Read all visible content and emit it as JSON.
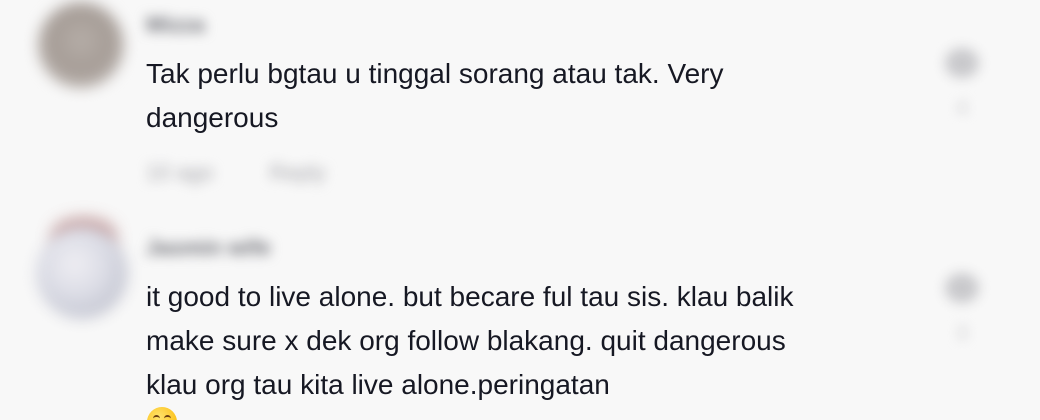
{
  "comments": [
    {
      "username": "Mizza",
      "text_lines": [
        "Tak perlu bgtau u tinggal sorang atau tak. Very",
        "dangerous"
      ],
      "time": "10 ago",
      "reply_label": "Reply",
      "like_count": "4"
    },
    {
      "username": "Jasmin wife",
      "text_lines": [
        "it good to live alone. but becare ful tau sis. klau balik",
        "make sure x dek org follow blakang. quit dangerous",
        "klau org tau kita live alone.peringatan"
      ],
      "emoji": "grinning-face-with-smiling-eyes",
      "like_count": "3"
    }
  ]
}
